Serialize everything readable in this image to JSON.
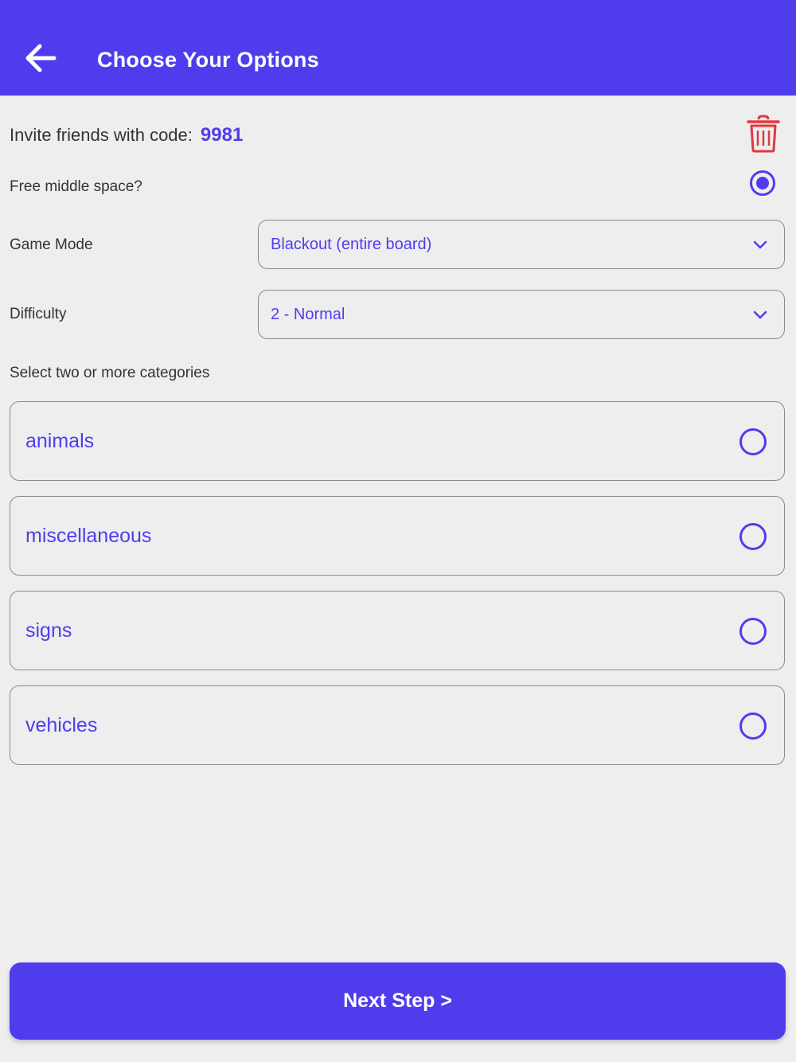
{
  "header": {
    "title": "Choose Your Options",
    "back_icon": "arrow-left-icon",
    "background_color": "#4f3ded"
  },
  "invite": {
    "label": "Invite friends with code:",
    "code": "9981",
    "delete_icon": "trash-icon",
    "delete_icon_color": "#e0383e"
  },
  "free_middle": {
    "label": "Free middle space?",
    "selected": true
  },
  "game_mode": {
    "label": "Game Mode",
    "value": "Blackout (entire board)"
  },
  "difficulty": {
    "label": "Difficulty",
    "value": "2 - Normal"
  },
  "categories": {
    "label": "Select two or more categories",
    "items": [
      {
        "label": "animals",
        "selected": false
      },
      {
        "label": "miscellaneous",
        "selected": false
      },
      {
        "label": "signs",
        "selected": false
      },
      {
        "label": "vehicles",
        "selected": false
      }
    ]
  },
  "next_button": {
    "label": "Next Step >"
  },
  "colors": {
    "accent": "#4f3ded",
    "background": "#eeeeee",
    "text": "#333333"
  }
}
